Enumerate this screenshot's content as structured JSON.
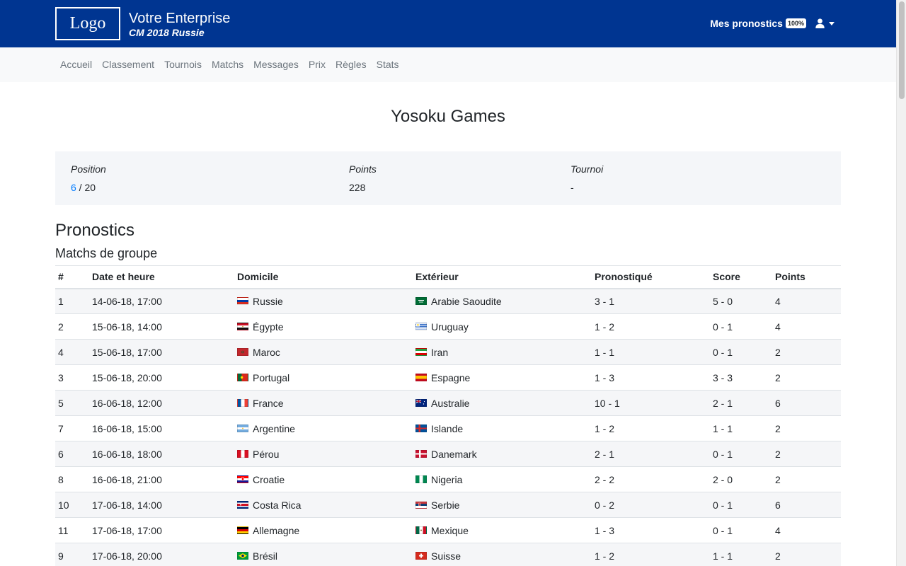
{
  "header": {
    "logo": "Logo",
    "company": "Votre Enterprise",
    "subtitle": "CM 2018 Russie",
    "mes_pronostics": "Mes pronostics",
    "progress_badge": "100%"
  },
  "nav": {
    "items": [
      "Accueil",
      "Classement",
      "Tournois",
      "Matchs",
      "Messages",
      "Prix",
      "Règles",
      "Stats"
    ]
  },
  "page": {
    "title": "Yosoku Games"
  },
  "stats": {
    "position_label": "Position",
    "position_rank": "6",
    "position_total": " / 20",
    "points_label": "Points",
    "points_value": "228",
    "tournoi_label": "Tournoi",
    "tournoi_value": "-"
  },
  "section": {
    "title": "Pronostics",
    "subtitle": "Matchs de groupe"
  },
  "table": {
    "columns": {
      "num": "#",
      "date": "Date et heure",
      "home": "Domicile",
      "away": "Extérieur",
      "pred": "Pronostiqué",
      "score": "Score",
      "points": "Points"
    },
    "rows": [
      {
        "num": "1",
        "date": "14-06-18, 17:00",
        "home": "Russie",
        "home_flag": "flag-russia-icon",
        "away": "Arabie Saoudite",
        "away_flag": "flag-saudi-arabia-icon",
        "pred": "3 - 1",
        "score": "5 - 0",
        "points": "4"
      },
      {
        "num": "2",
        "date": "15-06-18, 14:00",
        "home": "Égypte",
        "home_flag": "flag-egypt-icon",
        "away": "Uruguay",
        "away_flag": "flag-uruguay-icon",
        "pred": "1 - 2",
        "score": "0 - 1",
        "points": "4"
      },
      {
        "num": "4",
        "date": "15-06-18, 17:00",
        "home": "Maroc",
        "home_flag": "flag-morocco-icon",
        "away": "Iran",
        "away_flag": "flag-iran-icon",
        "pred": "1 - 1",
        "score": "0 - 1",
        "points": "2"
      },
      {
        "num": "3",
        "date": "15-06-18, 20:00",
        "home": "Portugal",
        "home_flag": "flag-portugal-icon",
        "away": "Espagne",
        "away_flag": "flag-spain-icon",
        "pred": "1 - 3",
        "score": "3 - 3",
        "points": "2"
      },
      {
        "num": "5",
        "date": "16-06-18, 12:00",
        "home": "France",
        "home_flag": "flag-france-icon",
        "away": "Australie",
        "away_flag": "flag-australia-icon",
        "pred": "10 - 1",
        "score": "2 - 1",
        "points": "6"
      },
      {
        "num": "7",
        "date": "16-06-18, 15:00",
        "home": "Argentine",
        "home_flag": "flag-argentina-icon",
        "away": "Islande",
        "away_flag": "flag-iceland-icon",
        "pred": "1 - 2",
        "score": "1 - 1",
        "points": "2"
      },
      {
        "num": "6",
        "date": "16-06-18, 18:00",
        "home": "Pérou",
        "home_flag": "flag-peru-icon",
        "away": "Danemark",
        "away_flag": "flag-denmark-icon",
        "pred": "2 - 1",
        "score": "0 - 1",
        "points": "2"
      },
      {
        "num": "8",
        "date": "16-06-18, 21:00",
        "home": "Croatie",
        "home_flag": "flag-croatia-icon",
        "away": "Nigeria",
        "away_flag": "flag-nigeria-icon",
        "pred": "2 - 2",
        "score": "2 - 0",
        "points": "2"
      },
      {
        "num": "10",
        "date": "17-06-18, 14:00",
        "home": "Costa Rica",
        "home_flag": "flag-costa-rica-icon",
        "away": "Serbie",
        "away_flag": "flag-serbia-icon",
        "pred": "0 - 2",
        "score": "0 - 1",
        "points": "6"
      },
      {
        "num": "11",
        "date": "17-06-18, 17:00",
        "home": "Allemagne",
        "home_flag": "flag-germany-icon",
        "away": "Mexique",
        "away_flag": "flag-mexico-icon",
        "pred": "1 - 3",
        "score": "0 - 1",
        "points": "4"
      },
      {
        "num": "9",
        "date": "17-06-18, 20:00",
        "home": "Brésil",
        "home_flag": "flag-brazil-icon",
        "away": "Suisse",
        "away_flag": "flag-switzerland-icon",
        "pred": "1 - 2",
        "score": "1 - 1",
        "points": "2"
      }
    ]
  },
  "colors": {
    "header_bg": "#003591",
    "nav_bg": "#f8f9fa",
    "link_blue": "#007bff",
    "stats_bg": "#f4f6f9"
  }
}
